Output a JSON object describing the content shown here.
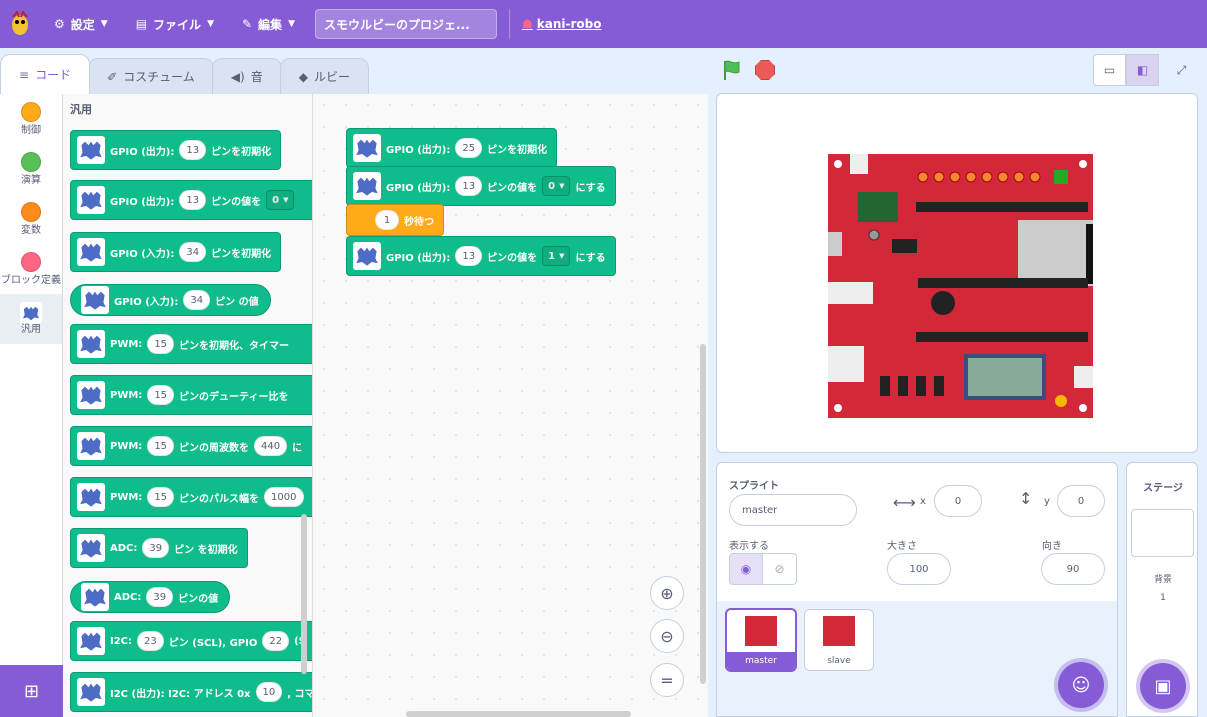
{
  "menubar": {
    "settings": "設定",
    "file": "ファイル",
    "edit": "編集",
    "project_title": "スモウルビーのプロジェ...",
    "user": "kani-robo"
  },
  "tabs": [
    "コード",
    "コスチューム",
    "音",
    "ルビー"
  ],
  "categories": [
    {
      "label": "制御",
      "color": "#ffab19"
    },
    {
      "label": "演算",
      "color": "#59c059"
    },
    {
      "label": "変数",
      "color": "#ff8c1a"
    },
    {
      "label": "ブロック定義",
      "color": "#ff6680"
    },
    {
      "label": "汎用",
      "color": "#4c6cc6"
    }
  ],
  "palette": {
    "title": "汎用",
    "blocks": [
      {
        "parts": [
          "GPIO (出力):",
          "13",
          "ピンを初期化"
        ]
      },
      {
        "parts": [
          "GPIO (出力):",
          "13",
          "ピンの値を",
          "0"
        ]
      },
      {
        "parts": [
          "GPIO (入力):",
          "34",
          "ピンを初期化"
        ]
      },
      {
        "parts": [
          "GPIO (入力):",
          "34",
          "ピン の値"
        ]
      },
      {
        "parts": [
          "PWM:",
          "15",
          "ピンを初期化、タイマー"
        ]
      },
      {
        "parts": [
          "PWM:",
          "15",
          "ピンのデューティー比を"
        ]
      },
      {
        "parts": [
          "PWM:",
          "15",
          "ピンの周波数を",
          "440",
          "に"
        ]
      },
      {
        "parts": [
          "PWM:",
          "15",
          "ピンのパルス幅を",
          "1000"
        ]
      },
      {
        "parts": [
          "ADC:",
          "39",
          "ピン を初期化"
        ]
      },
      {
        "parts": [
          "ADC:",
          "39",
          "ピンの値"
        ]
      },
      {
        "parts": [
          "I2C:",
          "23",
          "ピン (SCL), GPIO",
          "22",
          "(S"
        ]
      },
      {
        "parts": [
          "I2C (出力): I2C: アドレス 0x",
          "10",
          ", コマ"
        ]
      }
    ]
  },
  "script": [
    {
      "parts": [
        "GPIO (出力):",
        "25",
        "ピンを初期化"
      ]
    },
    {
      "parts": [
        "GPIO (出力):",
        "13",
        "ピンの値を",
        "0",
        "にする"
      ]
    },
    {
      "parts": [
        "1",
        "秒待つ"
      ]
    },
    {
      "parts": [
        "GPIO (出力):",
        "13",
        "ピンの値を",
        "1",
        "にする"
      ]
    }
  ],
  "sprite": {
    "label": "スプライト",
    "name": "master",
    "x_label": "x",
    "x": "0",
    "y_label": "y",
    "y": "0",
    "show_label": "表示する",
    "size_label": "大きさ",
    "size": "100",
    "direction_label": "向き",
    "direction": "90"
  },
  "sprites": [
    "master",
    "slave"
  ],
  "stage_panel": {
    "title": "ステージ",
    "backdrop_label": "背景",
    "backdrop_count": "1"
  }
}
